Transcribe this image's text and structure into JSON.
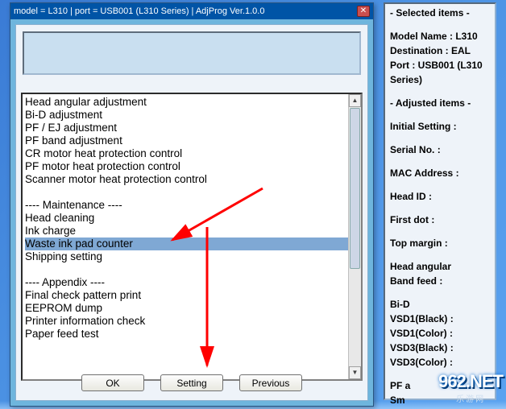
{
  "title": "model = L310 | port = USB001 (L310 Series) | AdjProg Ver.1.0.0",
  "list": [
    "Head angular adjustment",
    "Bi-D adjustment",
    "PF / EJ adjustment",
    "PF band adjustment",
    "CR motor heat protection control",
    "PF motor heat protection control",
    "Scanner motor heat protection control",
    "",
    "---- Maintenance ----",
    "Head cleaning",
    "Ink charge",
    "Waste ink pad counter",
    "Shipping setting",
    "",
    "---- Appendix ----",
    "Final check pattern print",
    "EEPROM dump",
    "Printer information check",
    "Paper feed test"
  ],
  "selected_index": 11,
  "buttons": {
    "ok": "OK",
    "setting": "Setting",
    "previous": "Previous"
  },
  "side": {
    "hdr_sel": "- Selected items -",
    "model": "Model Name : L310",
    "dest": "Destination : EAL",
    "port1": "Port : USB001 (L310",
    "port2": "Series)",
    "hdr_adj": "- Adjusted items -",
    "init": "Initial Setting :",
    "serial": "Serial No. :",
    "mac": "MAC Address :",
    "head": "Head ID :",
    "first": "First dot :",
    "top": "Top margin :",
    "ang1": "Head angular",
    "ang2": " Band feed :",
    "bid": "Bi-D",
    "v1b": " VSD1(Black) :",
    "v1c": " VSD1(Color) :",
    "v3b": " VSD3(Black) :",
    "v3c": " VSD3(Color) :",
    "pf": "PF a",
    "sm": "Sm"
  },
  "watermark": {
    "big": "962.NET",
    "small": "乐游网"
  }
}
